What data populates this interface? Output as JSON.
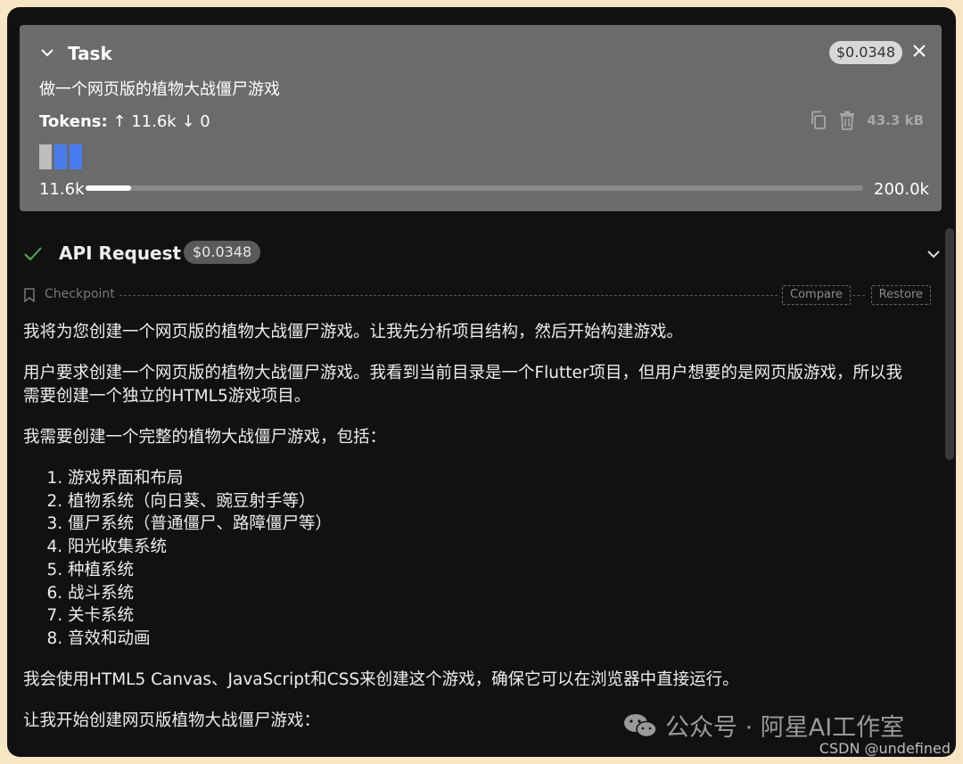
{
  "task": {
    "title": "Task",
    "cost": "$0.0348",
    "description": "做一个网页版的植物大战僵尸游戏",
    "tokens_label": "Tokens:",
    "tokens_in": "↑ 11.6k",
    "tokens_out": "↓ 0",
    "size": "43.3 kB",
    "context_used": "11.6k",
    "context_max": "200.0k",
    "context_fraction": 0.058
  },
  "api": {
    "label": "API Request",
    "cost": "$0.0348"
  },
  "checkpoint": {
    "label": "Checkpoint",
    "compare_label": "Compare",
    "restore_label": "Restore"
  },
  "message": {
    "p1": "我将为您创建一个网页版的植物大战僵尸游戏。让我先分析项目结构，然后开始构建游戏。",
    "p2": "用户要求创建一个网页版的植物大战僵尸游戏。我看到当前目录是一个Flutter项目，但用户想要的是网页版游戏，所以我需要创建一个独立的HTML5游戏项目。",
    "p3": "我需要创建一个完整的植物大战僵尸游戏，包括：",
    "list": [
      "游戏界面和布局",
      "植物系统（向日葵、豌豆射手等）",
      "僵尸系统（普通僵尸、路障僵尸等）",
      "阳光收集系统",
      "种植系统",
      "战斗系统",
      "关卡系统",
      "音效和动画"
    ],
    "p4": "我会使用HTML5 Canvas、JavaScript和CSS来创建这个游戏，确保它可以在浏览器中直接运行。",
    "p5": "让我开始创建网页版植物大战僵尸游戏："
  },
  "watermark": {
    "wechat": "公众号 · 阿星AI工作室",
    "csdn": "CSDN @undefined"
  }
}
